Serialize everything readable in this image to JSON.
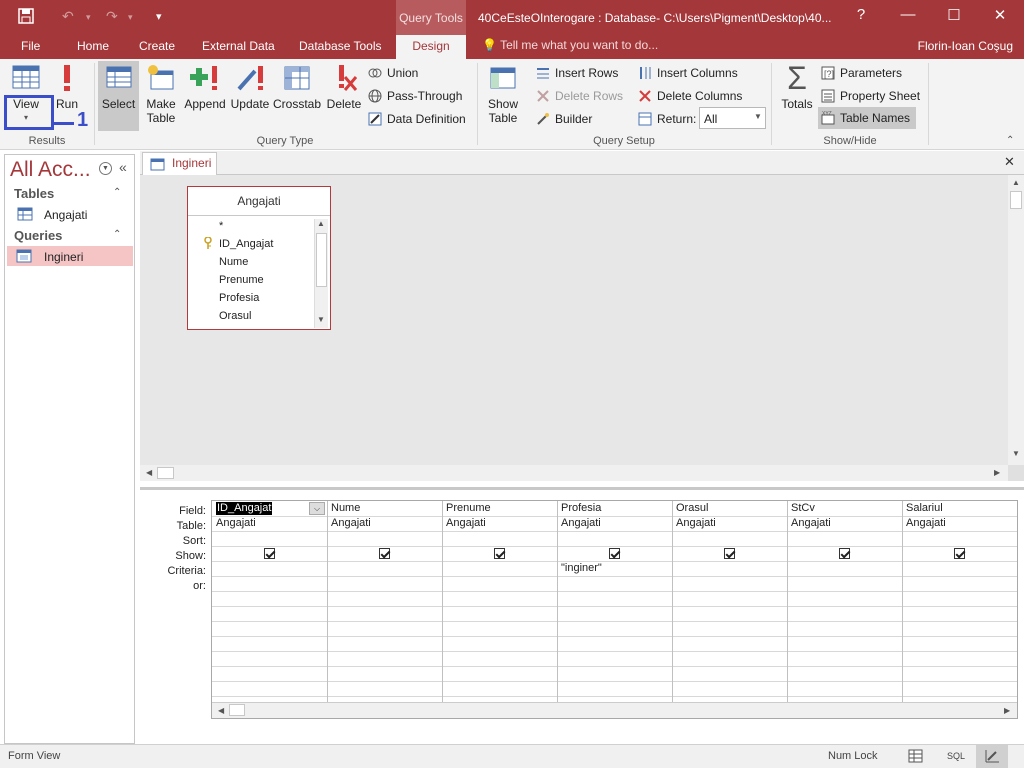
{
  "titlebar": {
    "context_label": "Query Tools",
    "window_title": "40CeEsteOInterogare : Database- C:\\Users\\Pigment\\Desktop\\40...",
    "help": "?",
    "minimize": "—",
    "maximize": "☐",
    "close": "✕"
  },
  "tabs": {
    "file": "File",
    "home": "Home",
    "create": "Create",
    "external_data": "External Data",
    "database_tools": "Database Tools",
    "design": "Design",
    "tell_me": "Tell me what you want to do...",
    "user": "Florin-Ioan Coşug"
  },
  "ribbon": {
    "results": {
      "view": "View",
      "run": "Run",
      "group": "Results"
    },
    "query_type": {
      "select": "Select",
      "make_table_1": "Make",
      "make_table_2": "Table",
      "append": "Append",
      "update": "Update",
      "crosstab": "Crosstab",
      "delete": "Delete",
      "union": "Union",
      "pass_through": "Pass-Through",
      "data_definition": "Data Definition",
      "group": "Query Type"
    },
    "query_setup": {
      "show_table_1": "Show",
      "show_table_2": "Table",
      "insert_rows": "Insert Rows",
      "delete_rows": "Delete Rows",
      "builder": "Builder",
      "insert_columns": "Insert Columns",
      "delete_columns": "Delete Columns",
      "return_label": "Return:",
      "return_value": "All",
      "group": "Query Setup"
    },
    "show_hide": {
      "totals": "Totals",
      "parameters": "Parameters",
      "property_sheet": "Property Sheet",
      "table_names": "Table Names",
      "group": "Show/Hide"
    },
    "annotation_number": "1"
  },
  "nav": {
    "title": "All Acc...",
    "tables_header": "Tables",
    "tables": [
      "Angajati"
    ],
    "queries_header": "Queries",
    "queries": [
      "Ingineri"
    ]
  },
  "document": {
    "tab_label": "Ingineri",
    "table_box": {
      "title": "Angajati",
      "fields": [
        "*",
        "ID_Angajat",
        "Nume",
        "Prenume",
        "Profesia",
        "Orasul"
      ]
    }
  },
  "qbe": {
    "row_labels": [
      "Field:",
      "Table:",
      "Sort:",
      "Show:",
      "Criteria:",
      "or:"
    ],
    "columns": [
      {
        "field": "ID_Angajat",
        "table": "Angajati",
        "show": true,
        "criteria": ""
      },
      {
        "field": "Nume",
        "table": "Angajati",
        "show": true,
        "criteria": ""
      },
      {
        "field": "Prenume",
        "table": "Angajati",
        "show": true,
        "criteria": ""
      },
      {
        "field": "Profesia",
        "table": "Angajati",
        "show": true,
        "criteria": "\"inginer\""
      },
      {
        "field": "Orasul",
        "table": "Angajati",
        "show": true,
        "criteria": ""
      },
      {
        "field": "StCv",
        "table": "Angajati",
        "show": true,
        "criteria": ""
      },
      {
        "field": "Salariul",
        "table": "Angajati",
        "show": true,
        "criteria": ""
      }
    ]
  },
  "status": {
    "left": "Form View",
    "num_lock": "Num Lock",
    "sql": "SQL"
  },
  "colors": {
    "accent": "#a4373a",
    "annotation": "#3b4ec9"
  }
}
